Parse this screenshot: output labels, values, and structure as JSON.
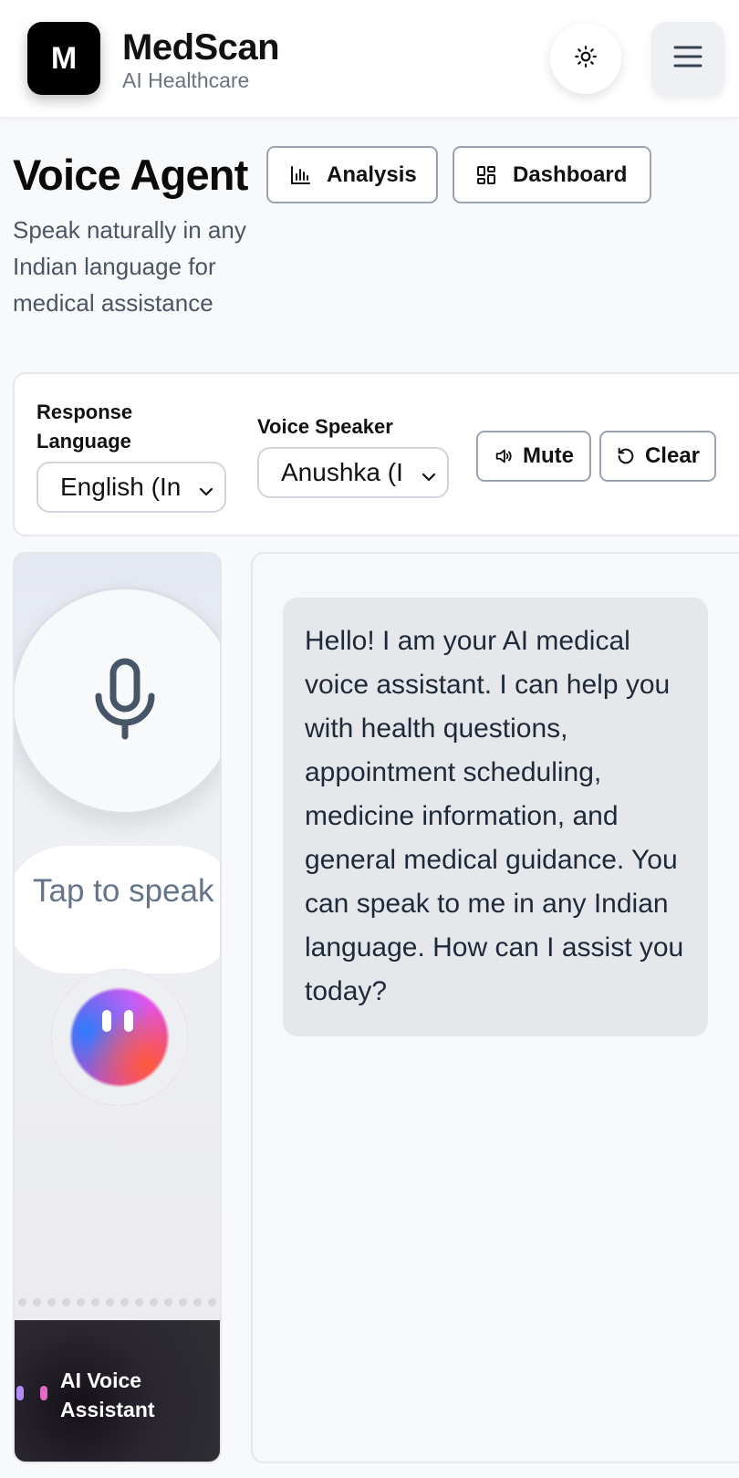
{
  "header": {
    "logo_letter": "M",
    "brand_name": "MedScan",
    "brand_sub": "AI Healthcare",
    "theme_toggle_icon": "sun-icon",
    "menu_icon": "hamburger-menu-icon"
  },
  "page": {
    "title": "Voice Agent",
    "subtitle": "Speak naturally in any Indian language for medical assistance",
    "nav": {
      "analysis_label": "Analysis",
      "analysis_icon": "bar-chart-icon",
      "dashboard_label": "Dashboard",
      "dashboard_icon": "dashboard-grid-icon"
    }
  },
  "controls": {
    "response_language_label": "Response Language",
    "response_language_value": "English (In",
    "voice_speaker_label": "Voice Speaker",
    "voice_speaker_value": "Anushka (I",
    "mute_label": "Mute",
    "mute_icon": "speaker-icon",
    "clear_label": "Clear",
    "clear_icon": "rotate-ccw-icon"
  },
  "voice_panel": {
    "mic_icon": "microphone-icon",
    "tap_label": "Tap to speak",
    "assistant_label": "AI Voice Assistant"
  },
  "chat": {
    "messages": [
      {
        "role": "assistant",
        "text": "Hello! I am your AI medical voice assistant. I can help you with health questions, appointment scheduling, medicine information, and general medical guidance. You can speak to me in any Indian language. How can I assist you today?"
      }
    ]
  },
  "colors": {
    "brand_black": "#000000",
    "bubble_bg": "#e5e7eb",
    "muted_text": "#6b7280",
    "panel_border": "#e5e7eb"
  }
}
